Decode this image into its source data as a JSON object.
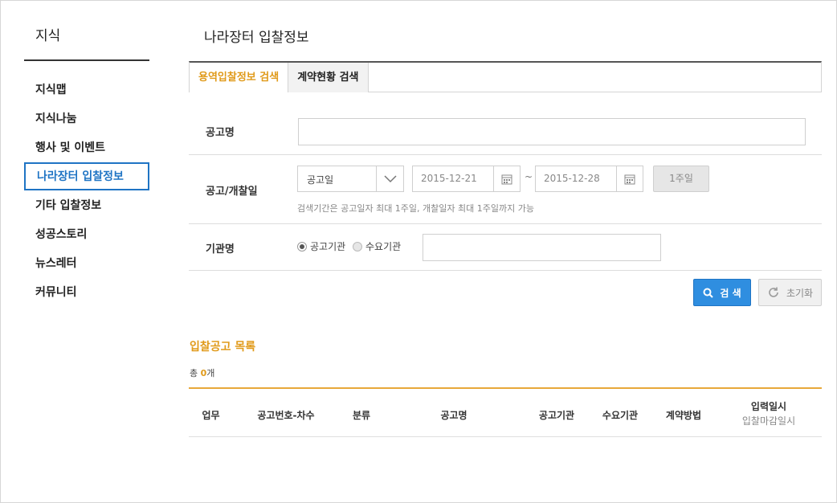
{
  "sidebar": {
    "title": "지식",
    "items": [
      {
        "label": "지식맵"
      },
      {
        "label": "지식나눔"
      },
      {
        "label": "행사 및 이벤트"
      },
      {
        "label": "나라장터 입찰정보"
      },
      {
        "label": "기타 입찰정보"
      },
      {
        "label": "성공스토리"
      },
      {
        "label": "뉴스레터"
      },
      {
        "label": "커뮤니티"
      }
    ],
    "active_index": 3
  },
  "main": {
    "title": "나라장터 입찰정보",
    "tabs": [
      {
        "label": "용역입찰정보 검색"
      },
      {
        "label": "계약현황 검색"
      }
    ],
    "form": {
      "notice_name_label": "공고명",
      "notice_name_value": "",
      "date_label": "공고/개찰일",
      "date_type_selected": "공고일",
      "date_from": "2015-12-21",
      "date_sep": "~",
      "date_to": "2015-12-28",
      "week_button": "1주일",
      "date_hint": "검색기간은 공고일자 최대 1주일, 개찰일자 최대 1주일까지 가능",
      "agency_label": "기관명",
      "radio_options": [
        "공고기관",
        "수요기관"
      ],
      "radio_selected": "공고기관",
      "agency_value": ""
    },
    "buttons": {
      "search": "검 색",
      "reset": "초기화"
    },
    "list": {
      "title": "입찰공고 목록",
      "count_prefix": "총 ",
      "count": "0",
      "count_suffix": "개",
      "columns": [
        "업무",
        "공고번호-차수",
        "분류",
        "공고명",
        "공고기관",
        "수요기관",
        "계약방법"
      ],
      "last_column": [
        "입력일시",
        "입찰마감일시"
      ]
    }
  },
  "colors": {
    "accent_orange": "#e09a1a",
    "active_blue": "#1f74c4",
    "search_button": "#2f8ee0"
  }
}
